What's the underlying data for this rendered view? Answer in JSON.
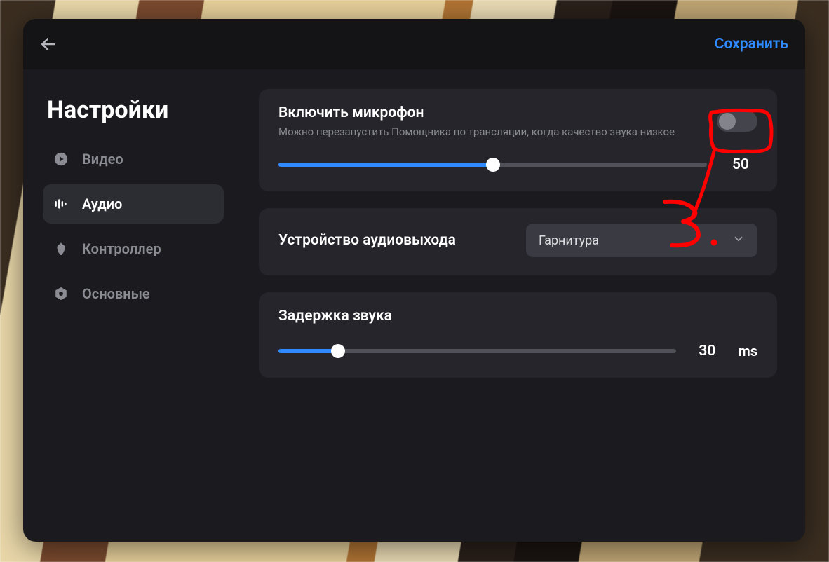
{
  "header": {
    "save_label": "Сохранить"
  },
  "sidebar": {
    "title": "Настройки",
    "items": [
      {
        "label": "Видео",
        "icon": "play"
      },
      {
        "label": "Аудио",
        "icon": "audio"
      },
      {
        "label": "Контроллер",
        "icon": "controller"
      },
      {
        "label": "Основные",
        "icon": "gear"
      }
    ],
    "active_index": 1
  },
  "audio": {
    "mic": {
      "title": "Включить микрофон",
      "subtitle": "Можно перезапустить Помощника по трансляции, когда качество звука низкое",
      "enabled": false,
      "volume_value": "50",
      "volume_percent": 50
    },
    "output": {
      "title": "Устройство аудиовыхода",
      "selected": "Гарнитура"
    },
    "delay": {
      "title": "Задержка звука",
      "value": "30",
      "unit": "ms",
      "percent": 15
    }
  },
  "annotation": {
    "label": "3."
  },
  "colors": {
    "accent": "#2f8bff",
    "annotation": "#ff0000"
  }
}
